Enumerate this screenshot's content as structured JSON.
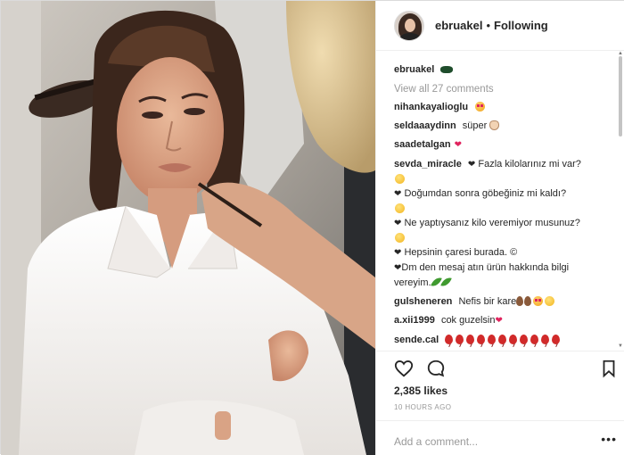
{
  "post": {
    "username": "ebruakel",
    "dot": "•",
    "follow_status": "Following",
    "view_all_comments": "View all 27 comments",
    "caption_user": "ebruakel",
    "likes": "2,385 likes",
    "time_ago": "10 HOURS AGO",
    "add_comment_placeholder": "Add a comment...",
    "more_options": "•••"
  },
  "comments": [
    {
      "user": "nihankayalioglu",
      "text": "",
      "emoji": [
        "heart-eyes"
      ]
    },
    {
      "user": "seldaaaydinn",
      "text": "süper",
      "emoji": [
        "clap"
      ]
    },
    {
      "user": "saadetalgan",
      "text": "",
      "emoji": [
        "heart"
      ]
    },
    {
      "user": "sevda_miracle",
      "lines": [
        "Fazla kilolarınız mi var?",
        "Doğumdan sonra göbeğiniz mi kaldı?",
        "Ne yaptıysanız kilo veremiyor musunuz?",
        "Hepsinin çaresi burada.",
        "Dm den mesaj atın ürün hakkında bilgi",
        "vereyim."
      ]
    },
    {
      "user": "gulsheneren",
      "text": "Nefis bir kare",
      "emoji": [
        "drop",
        "drop",
        "heart-eyes",
        "yellow"
      ]
    },
    {
      "user": "a.xii1999",
      "text": "cok guzelsin",
      "emoji": [
        "heart"
      ]
    },
    {
      "user": "sende.cal",
      "text": "",
      "emoji": [
        "balloon"
      ],
      "balloon_count": 11
    }
  ],
  "icons": {
    "like": "heart-outline-icon",
    "comment": "comment-bubble-icon",
    "save": "bookmark-icon"
  },
  "colors": {
    "text": "#262626",
    "muted": "#999999",
    "border": "#efefef",
    "heart": "#e0245e"
  }
}
